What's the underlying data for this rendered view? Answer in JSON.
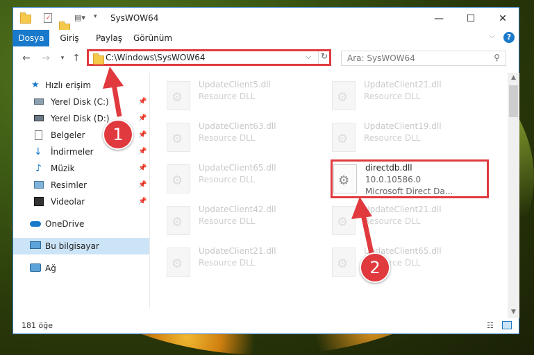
{
  "window": {
    "title": "SysWOW64",
    "controls": {
      "minimize": "—",
      "maximize": "☐",
      "close": "✕"
    }
  },
  "ribbon": {
    "tabs": [
      {
        "label": "Dosya",
        "active": true
      },
      {
        "label": "Giriş"
      },
      {
        "label": "Paylaş"
      },
      {
        "label": "Görünüm"
      }
    ]
  },
  "address": {
    "path": "C:\\Windows\\SysWOW64",
    "search_placeholder": "Ara: SysWOW64"
  },
  "sidebar": {
    "items": [
      {
        "label": "Hızlı erişim",
        "icon": "star-icon"
      },
      {
        "label": "Yerel Disk (C:)",
        "icon": "drive-icon",
        "pinned": true
      },
      {
        "label": "Yerel Disk (D:)",
        "icon": "drive-icon",
        "pinned": true
      },
      {
        "label": "Belgeler",
        "icon": "documents-icon",
        "pinned": true
      },
      {
        "label": "İndirmeler",
        "icon": "download-icon",
        "pinned": true
      },
      {
        "label": "Müzik",
        "icon": "music-icon",
        "pinned": true
      },
      {
        "label": "Resimler",
        "icon": "pictures-icon",
        "pinned": true
      },
      {
        "label": "Videolar",
        "icon": "video-icon",
        "pinned": true
      },
      {
        "label": "OneDrive",
        "icon": "cloud-icon"
      },
      {
        "label": "Bu bilgisayar",
        "icon": "computer-icon",
        "selected": true
      },
      {
        "label": "Ağ",
        "icon": "network-icon"
      }
    ]
  },
  "files": [
    {
      "name": "UpdateClient5.dll",
      "desc": "Resource DLL"
    },
    {
      "name": "UpdateClient21.dll",
      "desc": "Resource DLL"
    },
    {
      "name": "UpdateClient63.dll",
      "desc": "Resource DLL"
    },
    {
      "name": "UpdateClient19.dll",
      "desc": "Resource DLL"
    },
    {
      "name": "UpdateClient65.dll",
      "desc": "Resource DLL"
    },
    {
      "name": "directdb.dll",
      "version": "10.0.10586.0",
      "desc": "Microsoft Direct Da..."
    },
    {
      "name": "UpdateClient42.dll",
      "desc": "Resource DLL"
    },
    {
      "name": "UpdateClient21.dll",
      "desc": "Resource DLL"
    },
    {
      "name": "UpdateClient21.dll",
      "desc": "Resource DLL"
    },
    {
      "name": "UpdateClient65.dll",
      "desc": "Resource DLL"
    }
  ],
  "status": {
    "count": "181 öğe"
  },
  "callouts": {
    "one": "1",
    "two": "2"
  },
  "colors": {
    "accent": "#1979ca",
    "highlight": "#e0393e"
  }
}
